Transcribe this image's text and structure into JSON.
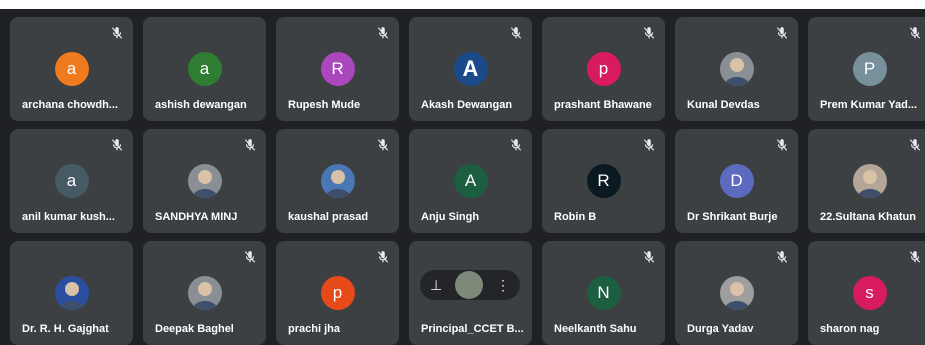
{
  "participants": [
    {
      "name": "archana chowdh...",
      "initial": "a",
      "color": "#f07b1e",
      "muted": true,
      "avatar_type": "initial"
    },
    {
      "name": "ashish dewangan",
      "initial": "a",
      "color": "#2e7d32",
      "muted": false,
      "avatar_type": "initial"
    },
    {
      "name": "Rupesh Mude",
      "initial": "R",
      "color": "#ab47bc",
      "muted": true,
      "avatar_type": "initial"
    },
    {
      "name": "Akash Dewangan",
      "initial": "A",
      "color": "#1a4a8a",
      "muted": true,
      "avatar_type": "initial"
    },
    {
      "name": "prashant Bhawane",
      "initial": "p",
      "color": "#d81b60",
      "muted": true,
      "avatar_type": "initial"
    },
    {
      "name": "Kunal Devdas",
      "initial": "",
      "color": "#8a8f94",
      "muted": true,
      "avatar_type": "photo"
    },
    {
      "name": "Prem Kumar Yad...",
      "initial": "P",
      "color": "#78909c",
      "muted": true,
      "avatar_type": "initial"
    },
    {
      "name": "anil kumar kush...",
      "initial": "a",
      "color": "#455a64",
      "muted": true,
      "avatar_type": "initial"
    },
    {
      "name": "SANDHYA MINJ",
      "initial": "",
      "color": "#8a8f94",
      "muted": true,
      "avatar_type": "photo"
    },
    {
      "name": "kaushal prasad",
      "initial": "",
      "color": "#4a78b5",
      "muted": true,
      "avatar_type": "photo"
    },
    {
      "name": "Anju Singh",
      "initial": "A",
      "color": "#1b5e40",
      "muted": true,
      "avatar_type": "initial"
    },
    {
      "name": "Robin B",
      "initial": "R",
      "color": "#0b1a22",
      "muted": true,
      "avatar_type": "initial"
    },
    {
      "name": "Dr Shrikant Burje",
      "initial": "D",
      "color": "#5c6bc0",
      "muted": true,
      "avatar_type": "initial"
    },
    {
      "name": "22.Sultana Khatun",
      "initial": "",
      "color": "#b3a698",
      "muted": true,
      "avatar_type": "photo"
    },
    {
      "name": "Dr. R. H. Gajghat",
      "initial": "",
      "color": "#2a4fa0",
      "muted": false,
      "avatar_type": "photo"
    },
    {
      "name": "Deepak Baghel",
      "initial": "",
      "color": "#8a8f94",
      "muted": true,
      "avatar_type": "photo"
    },
    {
      "name": "prachi jha",
      "initial": "p",
      "color": "#e64a19",
      "muted": true,
      "avatar_type": "initial"
    },
    {
      "name": "Principal_CCET B...",
      "initial": "",
      "color": "#7d8a7a",
      "muted": false,
      "avatar_type": "pinned"
    },
    {
      "name": "Neelkanth Sahu",
      "initial": "N",
      "color": "#1b5e40",
      "muted": true,
      "avatar_type": "initial"
    },
    {
      "name": "Durga Yadav",
      "initial": "",
      "color": "#9e9e9e",
      "muted": true,
      "avatar_type": "photo"
    },
    {
      "name": "sharon nag",
      "initial": "s",
      "color": "#d81b60",
      "muted": true,
      "avatar_type": "initial"
    }
  ],
  "icons": {
    "mute": "mic-off-icon",
    "pin": "pin-icon",
    "more": "more-vert-icon"
  },
  "pin_glyph": "⊥",
  "more_glyph": "⋮"
}
